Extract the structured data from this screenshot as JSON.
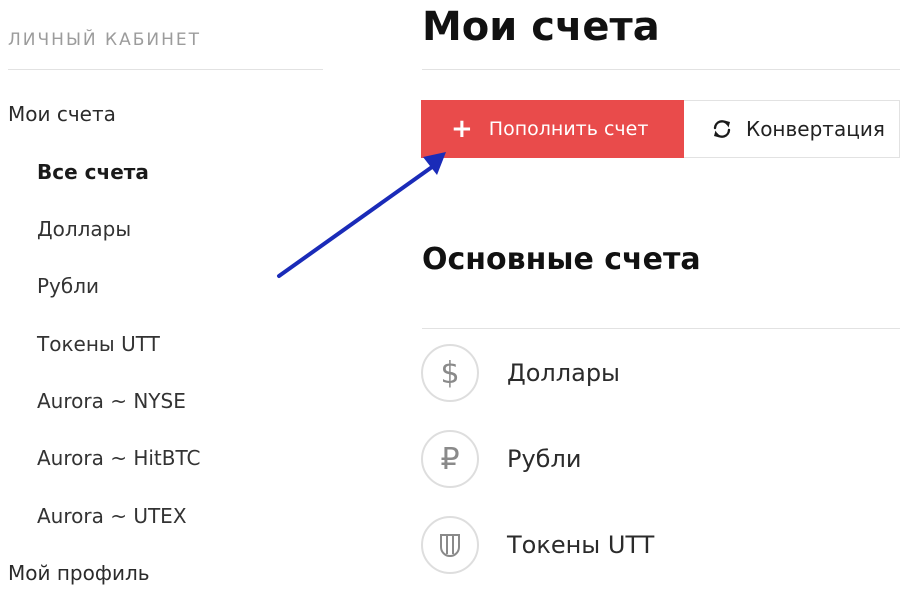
{
  "sidebar": {
    "title": "ЛИЧНЫЙ КАБИНЕТ",
    "my_accounts": "Мои счета",
    "sub_items": [
      "Все счета",
      "Доллары",
      "Рубли",
      "Токены UTT",
      "Aurora ~ NYSE",
      "Aurora ~ HitBTC",
      "Aurora ~ UTEX"
    ],
    "active_sub": "Все счета",
    "my_profile": "Мой профиль"
  },
  "main": {
    "title": "Мои счета",
    "topup_label": "Пополнить счет",
    "convert_label": "Конвертация",
    "section_title": "Основные счета",
    "accounts": [
      {
        "label": "Доллары",
        "icon": "dollar-icon",
        "glyph": "$"
      },
      {
        "label": "Рубли",
        "icon": "ruble-icon",
        "glyph": "₽"
      },
      {
        "label": "Токены UTT",
        "icon": "utt-token-icon",
        "glyph": ""
      }
    ]
  },
  "colors": {
    "accent_red": "#e94b4b",
    "arrow_blue": "#1a2bb8"
  }
}
